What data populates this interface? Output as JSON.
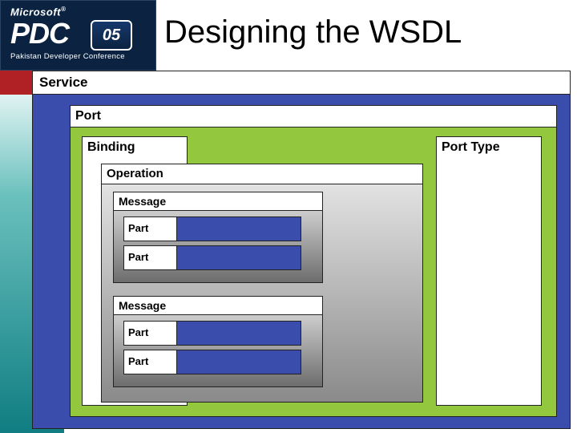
{
  "header": {
    "brand": "Microsoft",
    "reg": "®",
    "pdc": "PDC",
    "year": "05",
    "sub": "Pakistan Developer Conference",
    "title": "Designing the WSDL"
  },
  "diagram": {
    "service": "Service",
    "port": "Port",
    "portType": "Port Type",
    "binding": "Binding",
    "operation": "Operation",
    "messages": [
      {
        "label": "Message",
        "parts": [
          "Part",
          "Part"
        ]
      },
      {
        "label": "Message",
        "parts": [
          "Part",
          "Part"
        ]
      }
    ]
  }
}
